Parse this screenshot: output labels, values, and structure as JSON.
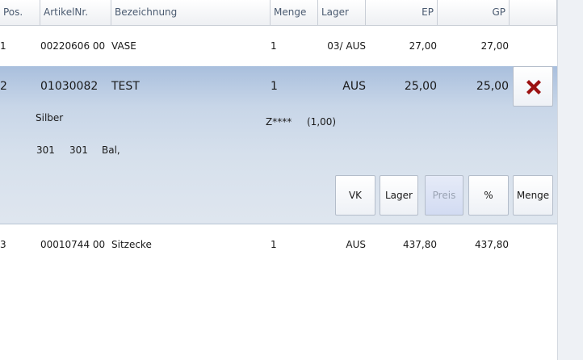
{
  "columns": {
    "pos": "Pos.",
    "artikelnr": "ArtikelNr.",
    "bezeichnung": "Bezeichnung",
    "menge": "Menge",
    "lager": "Lager",
    "ep": "EP",
    "gp": "GP"
  },
  "rows": [
    {
      "pos": "1",
      "artikelnr": "00220606 00",
      "bezeichnung": "VASE",
      "menge": "1",
      "lager": "03/ AUS",
      "ep": "27,00",
      "gp": "27,00"
    },
    {
      "pos": "2",
      "artikelnr": "01030082",
      "bezeichnung": "TEST",
      "menge": "1",
      "lager": "AUS",
      "ep": "25,00",
      "gp": "25,00",
      "detail": {
        "variant": "Silber",
        "code": "Z****",
        "code_value": "(1,00)",
        "extra1": "301",
        "extra2": "301",
        "extra3": "Bal,"
      }
    },
    {
      "pos": "3",
      "artikelnr": "00010744 00",
      "bezeichnung": "Sitzecke",
      "menge": "1",
      "lager": "AUS",
      "ep": "437,80",
      "gp": "437,80"
    }
  ],
  "actions": {
    "vk": "VK",
    "lager": "Lager",
    "preis": "Preis",
    "prozent": "%",
    "menge": "Menge"
  },
  "icons": {
    "delete": "x-delete-icon"
  },
  "colors": {
    "delete_icon": "#9b1111",
    "selection": "#c8d6e8",
    "header_text": "#4a5a70"
  }
}
